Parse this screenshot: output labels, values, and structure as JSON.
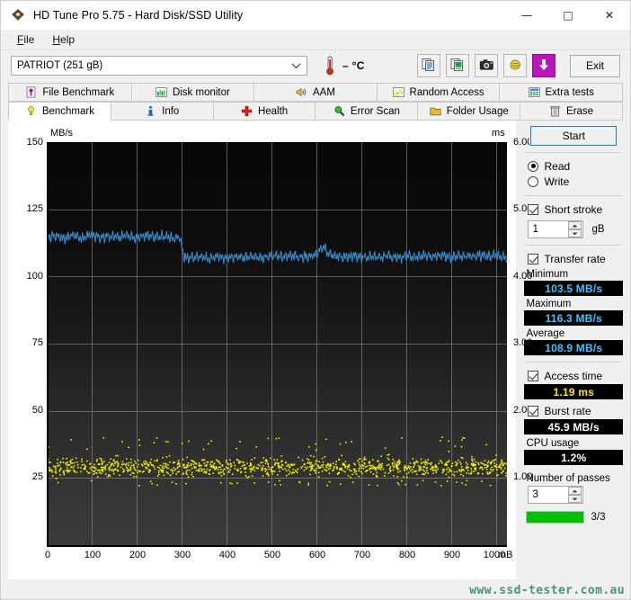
{
  "window": {
    "title": "HD Tune Pro 5.75 - Hard Disk/SSD Utility",
    "icon": "hdtune-logo-icon",
    "minimize": "—",
    "maximize": "□",
    "close": "✕"
  },
  "menu": {
    "items": [
      {
        "label": "File",
        "mnemonic": "F"
      },
      {
        "label": "Help",
        "mnemonic": "H"
      }
    ]
  },
  "toolbar": {
    "drive_selected": "PATRIOT (251 gB)",
    "drive_dropdown_icon": "chevron-down-icon",
    "temperature_icon": "thermometer-icon",
    "temperature_value": "– °C",
    "buttons": [
      {
        "name": "copy-to-clipboard-button",
        "icon": "copy-document-icon"
      },
      {
        "name": "export-spreadsheet-button",
        "icon": "copy-excel-icon"
      },
      {
        "name": "screenshot-button",
        "icon": "camera-icon"
      },
      {
        "name": "highlight-button",
        "icon": "hand-icon"
      },
      {
        "name": "download-button",
        "icon": "down-arrow-icon"
      }
    ],
    "exit_label": "Exit"
  },
  "tabs": {
    "row1": [
      {
        "label": "File Benchmark",
        "icon": "file-benchmark-icon",
        "active": false
      },
      {
        "label": "Disk monitor",
        "icon": "bar-chart-icon",
        "active": false
      },
      {
        "label": "AAM",
        "icon": "speaker-icon",
        "active": false
      },
      {
        "label": "Random Access",
        "icon": "scatter-icon",
        "active": false
      },
      {
        "label": "Extra tests",
        "icon": "calculator-icon",
        "active": false
      }
    ],
    "row2": [
      {
        "label": "Benchmark",
        "icon": "lightbulb-icon",
        "active": true
      },
      {
        "label": "Info",
        "icon": "info-icon",
        "active": false
      },
      {
        "label": "Health",
        "icon": "red-cross-icon",
        "active": false
      },
      {
        "label": "Error Scan",
        "icon": "magnifier-icon",
        "active": false
      },
      {
        "label": "Folder Usage",
        "icon": "folder-icon",
        "active": false
      },
      {
        "label": "Erase",
        "icon": "trash-icon",
        "active": false
      }
    ]
  },
  "panel": {
    "start_label": "Start",
    "mode": {
      "read_label": "Read",
      "write_label": "Write",
      "selected": "Read"
    },
    "short_stroke": {
      "label": "Short stroke",
      "checked": true,
      "value": "1",
      "unit": "gB"
    },
    "transfer_rate": {
      "label": "Transfer rate",
      "checked": true,
      "minimum_label": "Minimum",
      "minimum_value": "103.5 MB/s",
      "maximum_label": "Maximum",
      "maximum_value": "116.3 MB/s",
      "average_label": "Average",
      "average_value": "108.9 MB/s"
    },
    "access_time": {
      "label": "Access time",
      "checked": true,
      "value": "1.19 ms"
    },
    "burst_rate": {
      "label": "Burst rate",
      "checked": true,
      "value": "45.9 MB/s"
    },
    "cpu_usage": {
      "label": "CPU usage",
      "value": "1.2%"
    },
    "passes": {
      "label": "Number of passes",
      "value": "3",
      "progress_text": "3/3"
    }
  },
  "watermark": "www.ssd-tester.com.au",
  "colors": {
    "transfer_curve": "#3a8fd0",
    "access_points": "#f2f200",
    "lcd_blue": "#3dc4ff",
    "lcd_yellow": "#ffe400",
    "progress_green": "#00c000",
    "accent_purple": "#b915b9"
  },
  "chart_data": {
    "type": "line",
    "title": "",
    "xlabel": "mB",
    "ylabel": "MB/s",
    "y2label": "ms",
    "xlim": [
      0,
      1024
    ],
    "ylim": [
      0,
      150
    ],
    "y2lim": [
      0,
      6.3
    ],
    "grid": true,
    "legend": "none",
    "xticks": [
      0,
      100,
      200,
      300,
      400,
      500,
      600,
      700,
      800,
      900,
      1000
    ],
    "yticks": [
      25,
      50,
      75,
      100,
      125,
      150
    ],
    "y2ticks": [
      1.0,
      2.0,
      3.0,
      4.0,
      5.0,
      6.0
    ],
    "series": [
      {
        "name": "Transfer rate",
        "axis": "left",
        "unit": "MB/s",
        "color": "#3a8fd0",
        "summary": {
          "minimum": 103.5,
          "maximum": 116.3,
          "average": 108.9
        },
        "x": [
          0,
          20,
          40,
          60,
          80,
          100,
          120,
          140,
          160,
          180,
          200,
          220,
          240,
          260,
          280,
          295,
          305,
          320,
          340,
          360,
          380,
          400,
          420,
          440,
          460,
          480,
          500,
          520,
          540,
          560,
          580,
          600,
          615,
          625,
          640,
          660,
          680,
          700,
          720,
          740,
          760,
          780,
          800,
          820,
          840,
          860,
          880,
          900,
          920,
          940,
          960,
          980,
          1000,
          1020
        ],
        "y": [
          114.5,
          115.2,
          114.0,
          115.6,
          114.2,
          115.8,
          114.4,
          115.0,
          114.6,
          115.4,
          114.2,
          115.2,
          114.8,
          115.0,
          114.4,
          114.8,
          107.5,
          106.8,
          107.4,
          106.6,
          107.6,
          107.0,
          107.5,
          106.8,
          107.4,
          107.0,
          107.8,
          107.2,
          107.6,
          107.0,
          107.6,
          108.4,
          111.5,
          109.0,
          107.6,
          107.2,
          107.8,
          107.0,
          107.6,
          107.2,
          107.8,
          107.0,
          107.6,
          107.2,
          107.8,
          107.4,
          108.0,
          107.2,
          107.8,
          107.4,
          108.0,
          107.4,
          107.8,
          107.2
        ]
      },
      {
        "name": "Access time",
        "axis": "right",
        "unit": "ms",
        "color": "#f2f200",
        "style": "scatter",
        "average": 1.19,
        "range": [
          1.02,
          1.45
        ],
        "note": "Dense yellow scatter cloud spanning full width, concentrated between 1.05 and 1.35 ms"
      }
    ]
  }
}
